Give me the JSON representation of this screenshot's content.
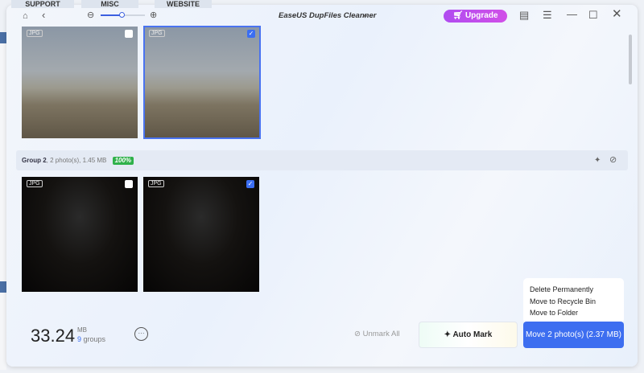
{
  "background_tabs": [
    "SUPPORT",
    "MISC",
    "WEBSITE"
  ],
  "app": {
    "title": "EaseUS DupFiles Cleanner",
    "upgrade_label": "Upgrade",
    "zoom_percent": 45
  },
  "groups": [
    {
      "photos": [
        {
          "type": "JPG",
          "checked": false
        },
        {
          "type": "JPG",
          "checked": true
        }
      ]
    },
    {
      "name": "Group 2",
      "info": ", 2 photo(s), 1.45 MB",
      "badge": "100%",
      "photos": [
        {
          "type": "JPG",
          "checked": false
        },
        {
          "type": "JPG",
          "checked": true
        }
      ]
    }
  ],
  "footer": {
    "total": "33.24",
    "unit": "MB",
    "groups_count": "9",
    "groups_label": "groups",
    "unmark_all": "Unmark All",
    "auto_mark": "Auto Mark",
    "move_button": "Move 2 photo(s) (2.37 MB)"
  },
  "move_menu": [
    "Delete Permanently",
    "Move to Recycle Bin",
    "Move to Folder"
  ],
  "check_mark": "✓"
}
